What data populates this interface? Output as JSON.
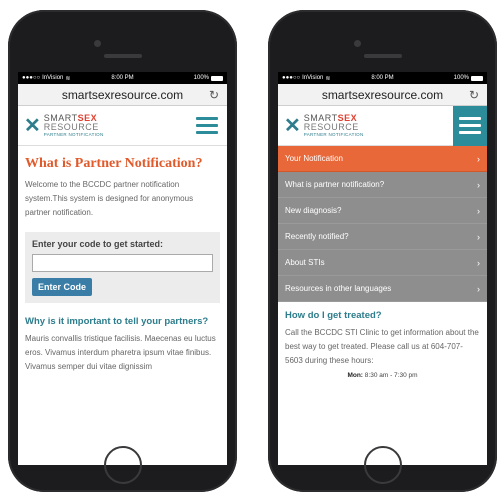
{
  "status": {
    "carrier": "InVision",
    "time": "8:00 PM",
    "battery": "100%"
  },
  "browser": {
    "url": "smartsexresource.com",
    "reload_icon": "reload-icon"
  },
  "logo": {
    "line1_prefix": "SMART",
    "line1_accent": "SEX",
    "line2": "RESOURCE",
    "line3": "PARTNER NOTIFICATION"
  },
  "left_screen": {
    "title": "What is Partner Notification?",
    "intro": "Welcome to the BCCDC partner notification system.This system is designed for anonymous partner notification.",
    "code_label": "Enter your code to get started:",
    "code_value": "",
    "enter_button": "Enter Code",
    "section_title": "Why is it important to tell your partners?",
    "section_body": "Mauris convallis tristique facilisis. Maecenas eu luctus eros. Vivamus interdum pharetra ipsum vitae finibus. Vivamus semper dui vitae dignissim"
  },
  "right_screen": {
    "menu_items": [
      {
        "label": "Your Notification",
        "active": true
      },
      {
        "label": "What is partner notification?",
        "active": false
      },
      {
        "label": "New diagnosis?",
        "active": false
      },
      {
        "label": "Recently notified?",
        "active": false
      },
      {
        "label": "About STIs",
        "active": false
      },
      {
        "label": "Resources in other languages",
        "active": false
      }
    ],
    "chevron": "›",
    "section_title": "How do I get treated?",
    "section_body": "Call the BCCDC STI Clinic to get information about the best way to get treated. Please call us at 604-707-5603 during these hours:",
    "hours_day": "Mon:",
    "hours_time": "8:30 am - 7:30 pm"
  },
  "colors": {
    "accent_orange": "#e05a2b",
    "teal": "#2d8c9a",
    "button_blue": "#3a7ea8",
    "menu_gray": "#8e8e8e"
  }
}
